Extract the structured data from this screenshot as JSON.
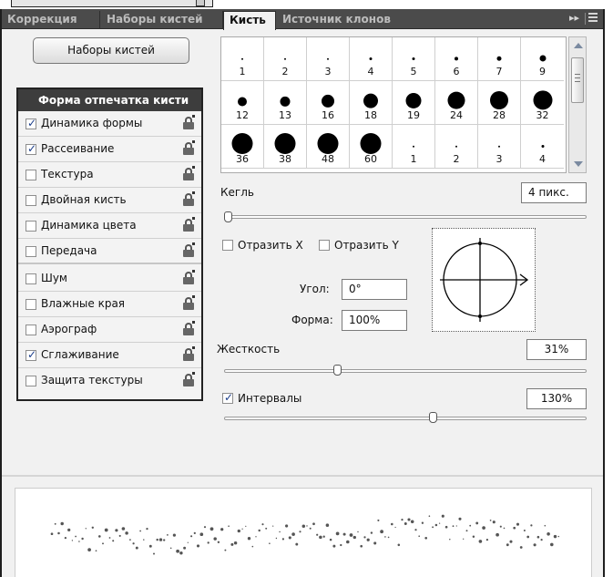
{
  "tabs": [
    {
      "label": "Коррекция",
      "active": false
    },
    {
      "label": "Наборы кистей",
      "active": false
    },
    {
      "label": "Кисть",
      "active": true
    },
    {
      "label": "Источник клонов",
      "active": false
    }
  ],
  "tab_controls": {
    "collapse": "▸▸"
  },
  "presets_button": "Наборы кистей",
  "options_header": "Форма отпечатка кисти",
  "options": [
    {
      "label": "Динамика формы",
      "checked": true
    },
    {
      "label": "Рассеивание",
      "checked": true
    },
    {
      "label": "Текстура",
      "checked": false
    },
    {
      "label": "Двойная кисть",
      "checked": false
    },
    {
      "label": "Динамика цвета",
      "checked": false
    },
    {
      "label": "Передача",
      "checked": false
    },
    {
      "label": "Шум",
      "checked": false
    },
    {
      "label": "Влажные края",
      "checked": false
    },
    {
      "label": "Аэрограф",
      "checked": false
    },
    {
      "label": "Сглаживание",
      "checked": true
    },
    {
      "label": "Защита текстуры",
      "checked": false
    }
  ],
  "brushes": [
    "1",
    "2",
    "3",
    "4",
    "5",
    "6",
    "7",
    "9",
    "12",
    "13",
    "16",
    "18",
    "19",
    "24",
    "28",
    "32",
    "36",
    "38",
    "48",
    "60",
    "1",
    "2",
    "3",
    "4"
  ],
  "size": {
    "label": "Кегль",
    "value": "4 пикс.",
    "level": 0.0
  },
  "flip_x": {
    "label": "Отразить X",
    "checked": false
  },
  "flip_y": {
    "label": "Отразить Y",
    "checked": false
  },
  "angle": {
    "label": "Угол:",
    "value": "0°"
  },
  "roundness": {
    "label": "Форма:",
    "value": "100%"
  },
  "hardness": {
    "label": "Жесткость",
    "value": "31%",
    "level": 0.31
  },
  "spacing": {
    "label": "Интервалы",
    "value": "130%",
    "checked": true,
    "level": 0.58
  }
}
